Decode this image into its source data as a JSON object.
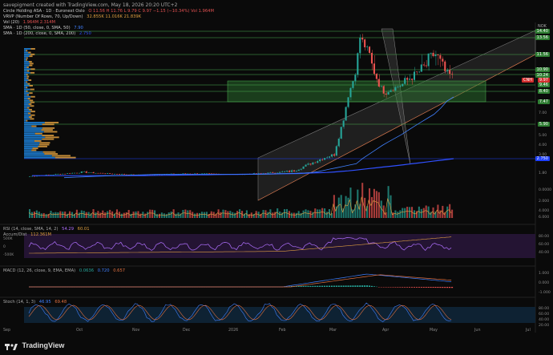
{
  "header": {
    "credit": "savepigment created with TradingView.com, May 18, 2026 20:20 UTC+2"
  },
  "legend": [
    {
      "name": "Circle Holding ASA · 1D · Euronext Oslo",
      "values": "O 11.56  H 11.76  L 9.79  C 9.97  −1.15 (−10.34%)  Vol 1.964M",
      "color": "#e05050"
    },
    {
      "name": "VRVP (Number Of Rows, 70, Up/Down)",
      "values": "32.855K  11.016K  21.839K",
      "color": "#e0a040"
    },
    {
      "name": "Vol (20)",
      "values": "1.964M  2.314M",
      "color": "#e05050"
    },
    {
      "name": "SMA · 1D (50, close, 0, SMA, 50)",
      "values": "7.90",
      "color": "#4080ff"
    },
    {
      "name": "SMA · 1D (200, close, 0, SMA, 200)",
      "values": "2.750",
      "color": "#3050ff"
    }
  ],
  "price_axis": {
    "currency": "NOK",
    "ticks": [
      "13.50",
      "11.56",
      "10.90",
      "10.24",
      "9.97",
      "9.46",
      "8.40",
      "7.00",
      "6.00",
      "5.00",
      "4.00",
      "3.00",
      "2.750",
      "1.80",
      "0.0000",
      "2.000",
      "4.000",
      "6.000"
    ],
    "markers": [
      {
        "label": "14.40",
        "color": "#2e7d32"
      },
      {
        "label": "13.56",
        "color": "#2e7d32"
      },
      {
        "label": "11.56",
        "color": "#2e7d32"
      },
      {
        "label": "10.90",
        "color": "#2e7d32"
      },
      {
        "label": "10.24",
        "color": "#2e7d32"
      },
      {
        "label": "9.97",
        "color": "#d32f2f"
      },
      {
        "label": "9.46",
        "color": "#2e7d32"
      },
      {
        "label": "8.40",
        "color": "#2e7d32"
      },
      {
        "label": "7.47",
        "color": "#2e7d32"
      },
      {
        "label": "5.90",
        "color": "#2e7d32"
      },
      {
        "label": "2.750",
        "color": "#1e40ff"
      }
    ],
    "cnh_label": "CNH"
  },
  "rsi": {
    "label": "RSI (14, close, SMA, 14, 2)",
    "value": "54.29",
    "value2": "60.01",
    "color": "#b070ff",
    "ticks": [
      "80.00",
      "60.00",
      "40.00"
    ],
    "left_ticks": [
      "500K",
      "0",
      "-500K"
    ]
  },
  "accdist": {
    "label": "Accum/Dist",
    "value": "112.361M"
  },
  "macd": {
    "label": "MACD (12, 26, close, 9, EMA, EMA)",
    "values": [
      "0.0636",
      "0.720",
      "0.657"
    ],
    "ticks": [
      "1.000",
      "0.000",
      "-1.000"
    ]
  },
  "stoch": {
    "label": "Stoch (14, 1, 3)",
    "values": [
      "46.95",
      "69.48"
    ],
    "ticks": [
      "80.00",
      "60.00",
      "40.00",
      "20.00"
    ]
  },
  "time_axis": [
    "Sep",
    "Oct",
    "Nov",
    "Dec",
    "2026",
    "Feb",
    "Mar",
    "Apr",
    "May",
    "Jun",
    "Jul"
  ],
  "brand": "TradingView",
  "colors": {
    "up": "#26a69a",
    "down": "#ef5350",
    "zone": "#2e7d32",
    "sma50": "#4080ff",
    "sma200": "#3050ff"
  },
  "chart_data": {
    "type": "candlestick",
    "title": "Circle Holding ASA · 1D · Euronext Oslo",
    "ylabel": "NOK",
    "ylim": [
      0,
      15
    ],
    "x": [
      "Sep",
      "Oct",
      "Nov",
      "Dec",
      "2026",
      "Feb",
      "Mar",
      "Apr",
      "May"
    ],
    "close": [
      1.2,
      1.8,
      1.4,
      1.6,
      1.5,
      1.9,
      3.5,
      11.5,
      9.97
    ],
    "series": [
      {
        "name": "SMA 50",
        "values": [
          1.0,
          1.3,
          1.5,
          1.5,
          1.5,
          1.7,
          2.4,
          5.2,
          7.9
        ]
      },
      {
        "name": "SMA 200",
        "values": [
          1.3,
          1.3,
          1.3,
          1.4,
          1.5,
          1.6,
          1.9,
          2.3,
          2.75
        ]
      }
    ]
  }
}
